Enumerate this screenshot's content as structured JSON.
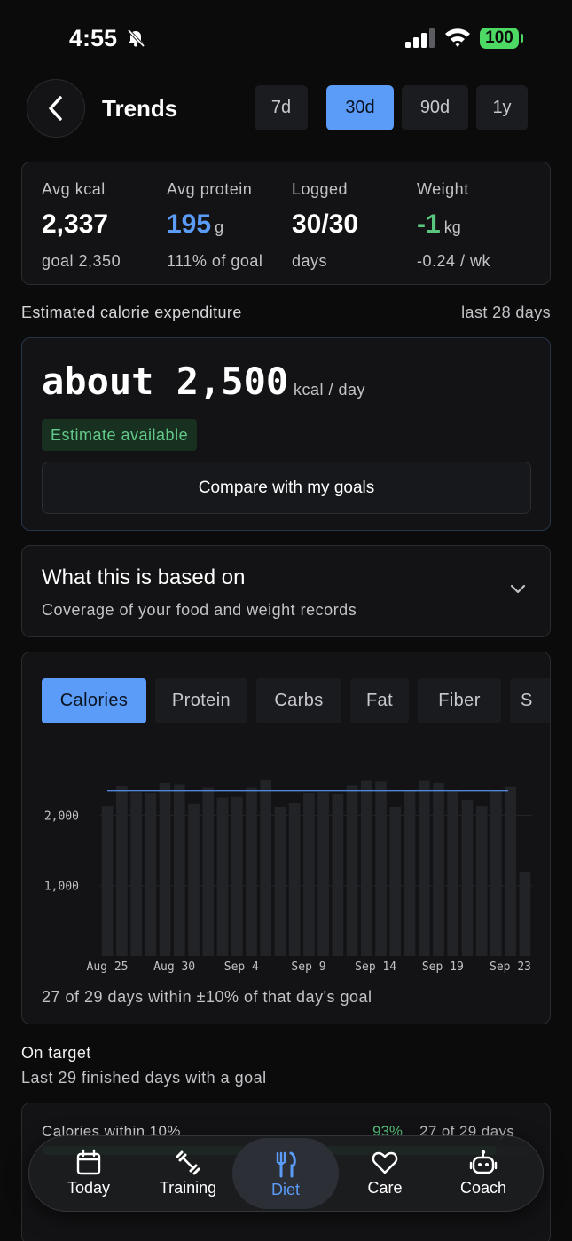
{
  "status": {
    "time": "4:55",
    "battery": "100"
  },
  "header": {
    "title": "Trends",
    "ranges": [
      {
        "label": "7d",
        "active": false
      },
      {
        "label": "30d",
        "active": true
      },
      {
        "label": "90d",
        "active": false
      },
      {
        "label": "1y",
        "active": false
      }
    ]
  },
  "stats": [
    {
      "label": "Avg kcal",
      "value": "2,337",
      "unit": "",
      "sub": "goal 2,350"
    },
    {
      "label": "Avg protein",
      "value": "195",
      "unit": "g",
      "sub": "111% of goal"
    },
    {
      "label": "Logged",
      "value": "30/30",
      "unit": "",
      "sub": "days"
    },
    {
      "label": "Weight",
      "value": "-1",
      "unit": "kg",
      "sub": "-0.24 / wk"
    }
  ],
  "estimate": {
    "section_label": "Estimated calorie expenditure",
    "period": "last 28 days",
    "value": "about 2,500",
    "unit": "kcal / day",
    "badge": "Estimate available",
    "compare_button": "Compare with my goals"
  },
  "based_on": {
    "title": "What this is based on",
    "subtitle": "Coverage of your food and weight records"
  },
  "metric_tabs": [
    "Calories",
    "Protein",
    "Carbs",
    "Fat",
    "Fiber",
    "S"
  ],
  "chart_data": {
    "type": "bar",
    "ylim": [
      0,
      2800
    ],
    "yticks": [
      2000,
      1000
    ],
    "ytick_labels": [
      "2,000",
      "1,000"
    ],
    "goal_line": 2350,
    "xtick_labels": [
      "Aug 25",
      "Aug 30",
      "Sep 4",
      "Sep 9",
      "Sep 14",
      "Sep 19",
      "Sep 23"
    ],
    "values": [
      2130,
      2420,
      2330,
      2320,
      2460,
      2440,
      2160,
      2390,
      2250,
      2260,
      2390,
      2500,
      2120,
      2170,
      2320,
      2330,
      2300,
      2430,
      2490,
      2480,
      2120,
      2350,
      2490,
      2460,
      2340,
      2220,
      2130,
      2340,
      2400,
      1200
    ],
    "caption": "27 of 29 days within ±10% of that day's goal"
  },
  "on_target": {
    "title": "On target",
    "subtitle": "Last 29 finished days with a goal",
    "row_label": "Calories within 10%",
    "percent": "93%",
    "days": "27 of 29 days",
    "fraction": 0.93
  },
  "tab_bar": [
    {
      "label": "Today",
      "icon": "calendar-icon"
    },
    {
      "label": "Training",
      "icon": "dumbbell-icon"
    },
    {
      "label": "Diet",
      "icon": "fork-knife-icon"
    },
    {
      "label": "Care",
      "icon": "heart-icon"
    },
    {
      "label": "Coach",
      "icon": "robot-icon"
    }
  ],
  "colors": {
    "accent": "#5a9cf8",
    "positive": "#58c67e",
    "background": "#0b0b0c",
    "card": "#131315"
  }
}
